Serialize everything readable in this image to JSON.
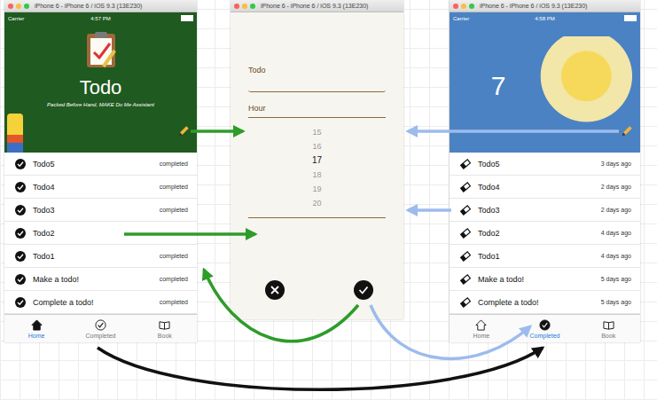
{
  "home_screen": {
    "title": "iPhone 6 - iPhone 6 / iOS 9.3 (13E230)",
    "carrier": "Carrier",
    "time": "4:57 PM",
    "header": {
      "kind": "logo",
      "title": "Todo",
      "subtitle": "Packed Before Hand, MAKE Do Me Assistant",
      "color": "#1f5a20"
    },
    "rows": [
      {
        "title": "Todo5",
        "status": "completed",
        "kind": "done"
      },
      {
        "title": "Todo4",
        "status": "completed",
        "kind": "done"
      },
      {
        "title": "Todo3",
        "status": "completed",
        "kind": "done"
      },
      {
        "title": "Todo2",
        "status": "",
        "kind": "done"
      },
      {
        "title": "Todo1",
        "status": "completed",
        "kind": "done"
      },
      {
        "title": "Make a todo!",
        "status": "completed",
        "kind": "done"
      },
      {
        "title": "Complete a todo!",
        "status": "completed",
        "kind": "done"
      }
    ],
    "tabs": [
      {
        "label": "Home",
        "selected": true
      },
      {
        "label": "Completed",
        "selected": false
      },
      {
        "label": "Book",
        "selected": false
      }
    ]
  },
  "form_screen": {
    "title": "iPhone 6 - iPhone 6 / iOS 9.3 (13E230)",
    "fields": [
      {
        "label": "Todo",
        "value": ""
      }
    ],
    "picker": {
      "label": "Hour",
      "items": [
        {
          "label": "15",
          "selected": false
        },
        {
          "label": "16",
          "selected": false
        },
        {
          "label": "17",
          "selected": true
        },
        {
          "label": "18",
          "selected": false
        },
        {
          "label": "19",
          "selected": false
        },
        {
          "label": "20",
          "selected": false
        }
      ]
    }
  },
  "completed_screen": {
    "title": "iPhone 6 - iPhone 6 / iOS 9.3 (13E230)",
    "carrier": "Carrier",
    "time": "4:58 PM",
    "header": {
      "kind": "count",
      "title": "7",
      "subtitle": "",
      "color": "#4b82c3"
    },
    "rows": [
      {
        "title": "Todo5",
        "status": "3 days ago",
        "kind": "erase"
      },
      {
        "title": "Todo4",
        "status": "2 days ago",
        "kind": "erase"
      },
      {
        "title": "Todo3",
        "status": "2 days ago",
        "kind": "erase"
      },
      {
        "title": "Todo2",
        "status": "4 days ago",
        "kind": "erase"
      },
      {
        "title": "Todo1",
        "status": "4 days ago",
        "kind": "erase"
      },
      {
        "title": "Make a todo!",
        "status": "5 days ago",
        "kind": "erase"
      },
      {
        "title": "Complete a todo!",
        "status": "5 days ago",
        "kind": "erase"
      }
    ],
    "tabs": [
      {
        "label": "Home",
        "selected": false
      },
      {
        "label": "Completed",
        "selected": true
      },
      {
        "label": "Book",
        "selected": false
      }
    ]
  },
  "arrows": [
    {
      "color": "#2e9c2a"
    },
    {
      "color": "#2e9c2a"
    },
    {
      "color": "#2e9c2a"
    },
    {
      "color": "#9dbbec"
    },
    {
      "color": "#9dbbec"
    },
    {
      "color": "#9dbbec"
    },
    {
      "color": "#111111"
    }
  ]
}
